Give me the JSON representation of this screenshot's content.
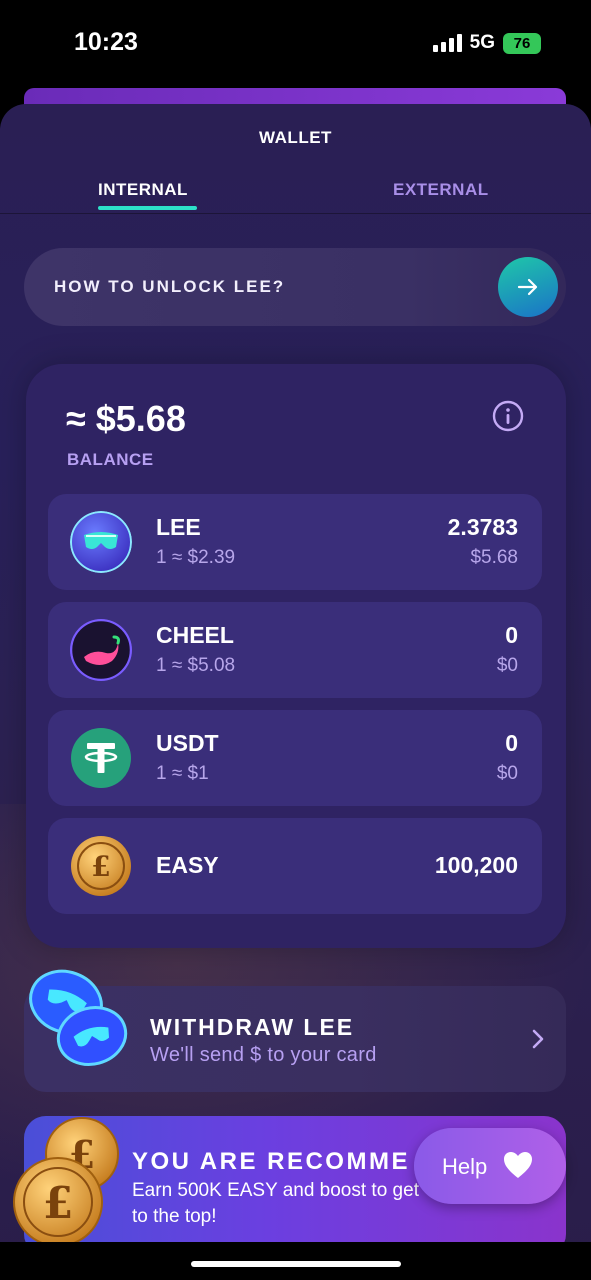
{
  "status_bar": {
    "time": "10:23",
    "network": "5G",
    "battery": "76"
  },
  "wallet": {
    "title": "WALLET",
    "tabs": [
      {
        "label": "INTERNAL",
        "active": true
      },
      {
        "label": "EXTERNAL",
        "active": false
      }
    ]
  },
  "unlock": {
    "label": "HOW TO UNLOCK LEE?"
  },
  "balance": {
    "amount": "≈ $5.68",
    "label": "BALANCE",
    "assets": [
      {
        "name": "LEE",
        "rate": "1 ≈ $2.39",
        "amount": "2.3783",
        "usd": "$5.68",
        "icon": "lee-token-icon"
      },
      {
        "name": "CHEEL",
        "rate": "1 ≈ $5.08",
        "amount": "0",
        "usd": "$0",
        "icon": "cheel-token-icon"
      },
      {
        "name": "USDT",
        "rate": "1 ≈ $1",
        "amount": "0",
        "usd": "$0",
        "icon": "usdt-token-icon"
      },
      {
        "name": "EASY",
        "amount": "100,200",
        "icon": "easy-coin-icon"
      }
    ]
  },
  "withdraw": {
    "title": "WITHDRAW LEE",
    "subtitle": "We'll send $ to your card"
  },
  "promo": {
    "title": "YOU ARE RECOMME",
    "text": "Earn 500K EASY and boost to get to the top!"
  },
  "help": {
    "label": "Help"
  },
  "colors": {
    "accent_teal": "#2de0c8",
    "muted_purple": "#b7a0f2",
    "card_bg": "#2f2363",
    "row_bg": "#3a2e7a"
  }
}
